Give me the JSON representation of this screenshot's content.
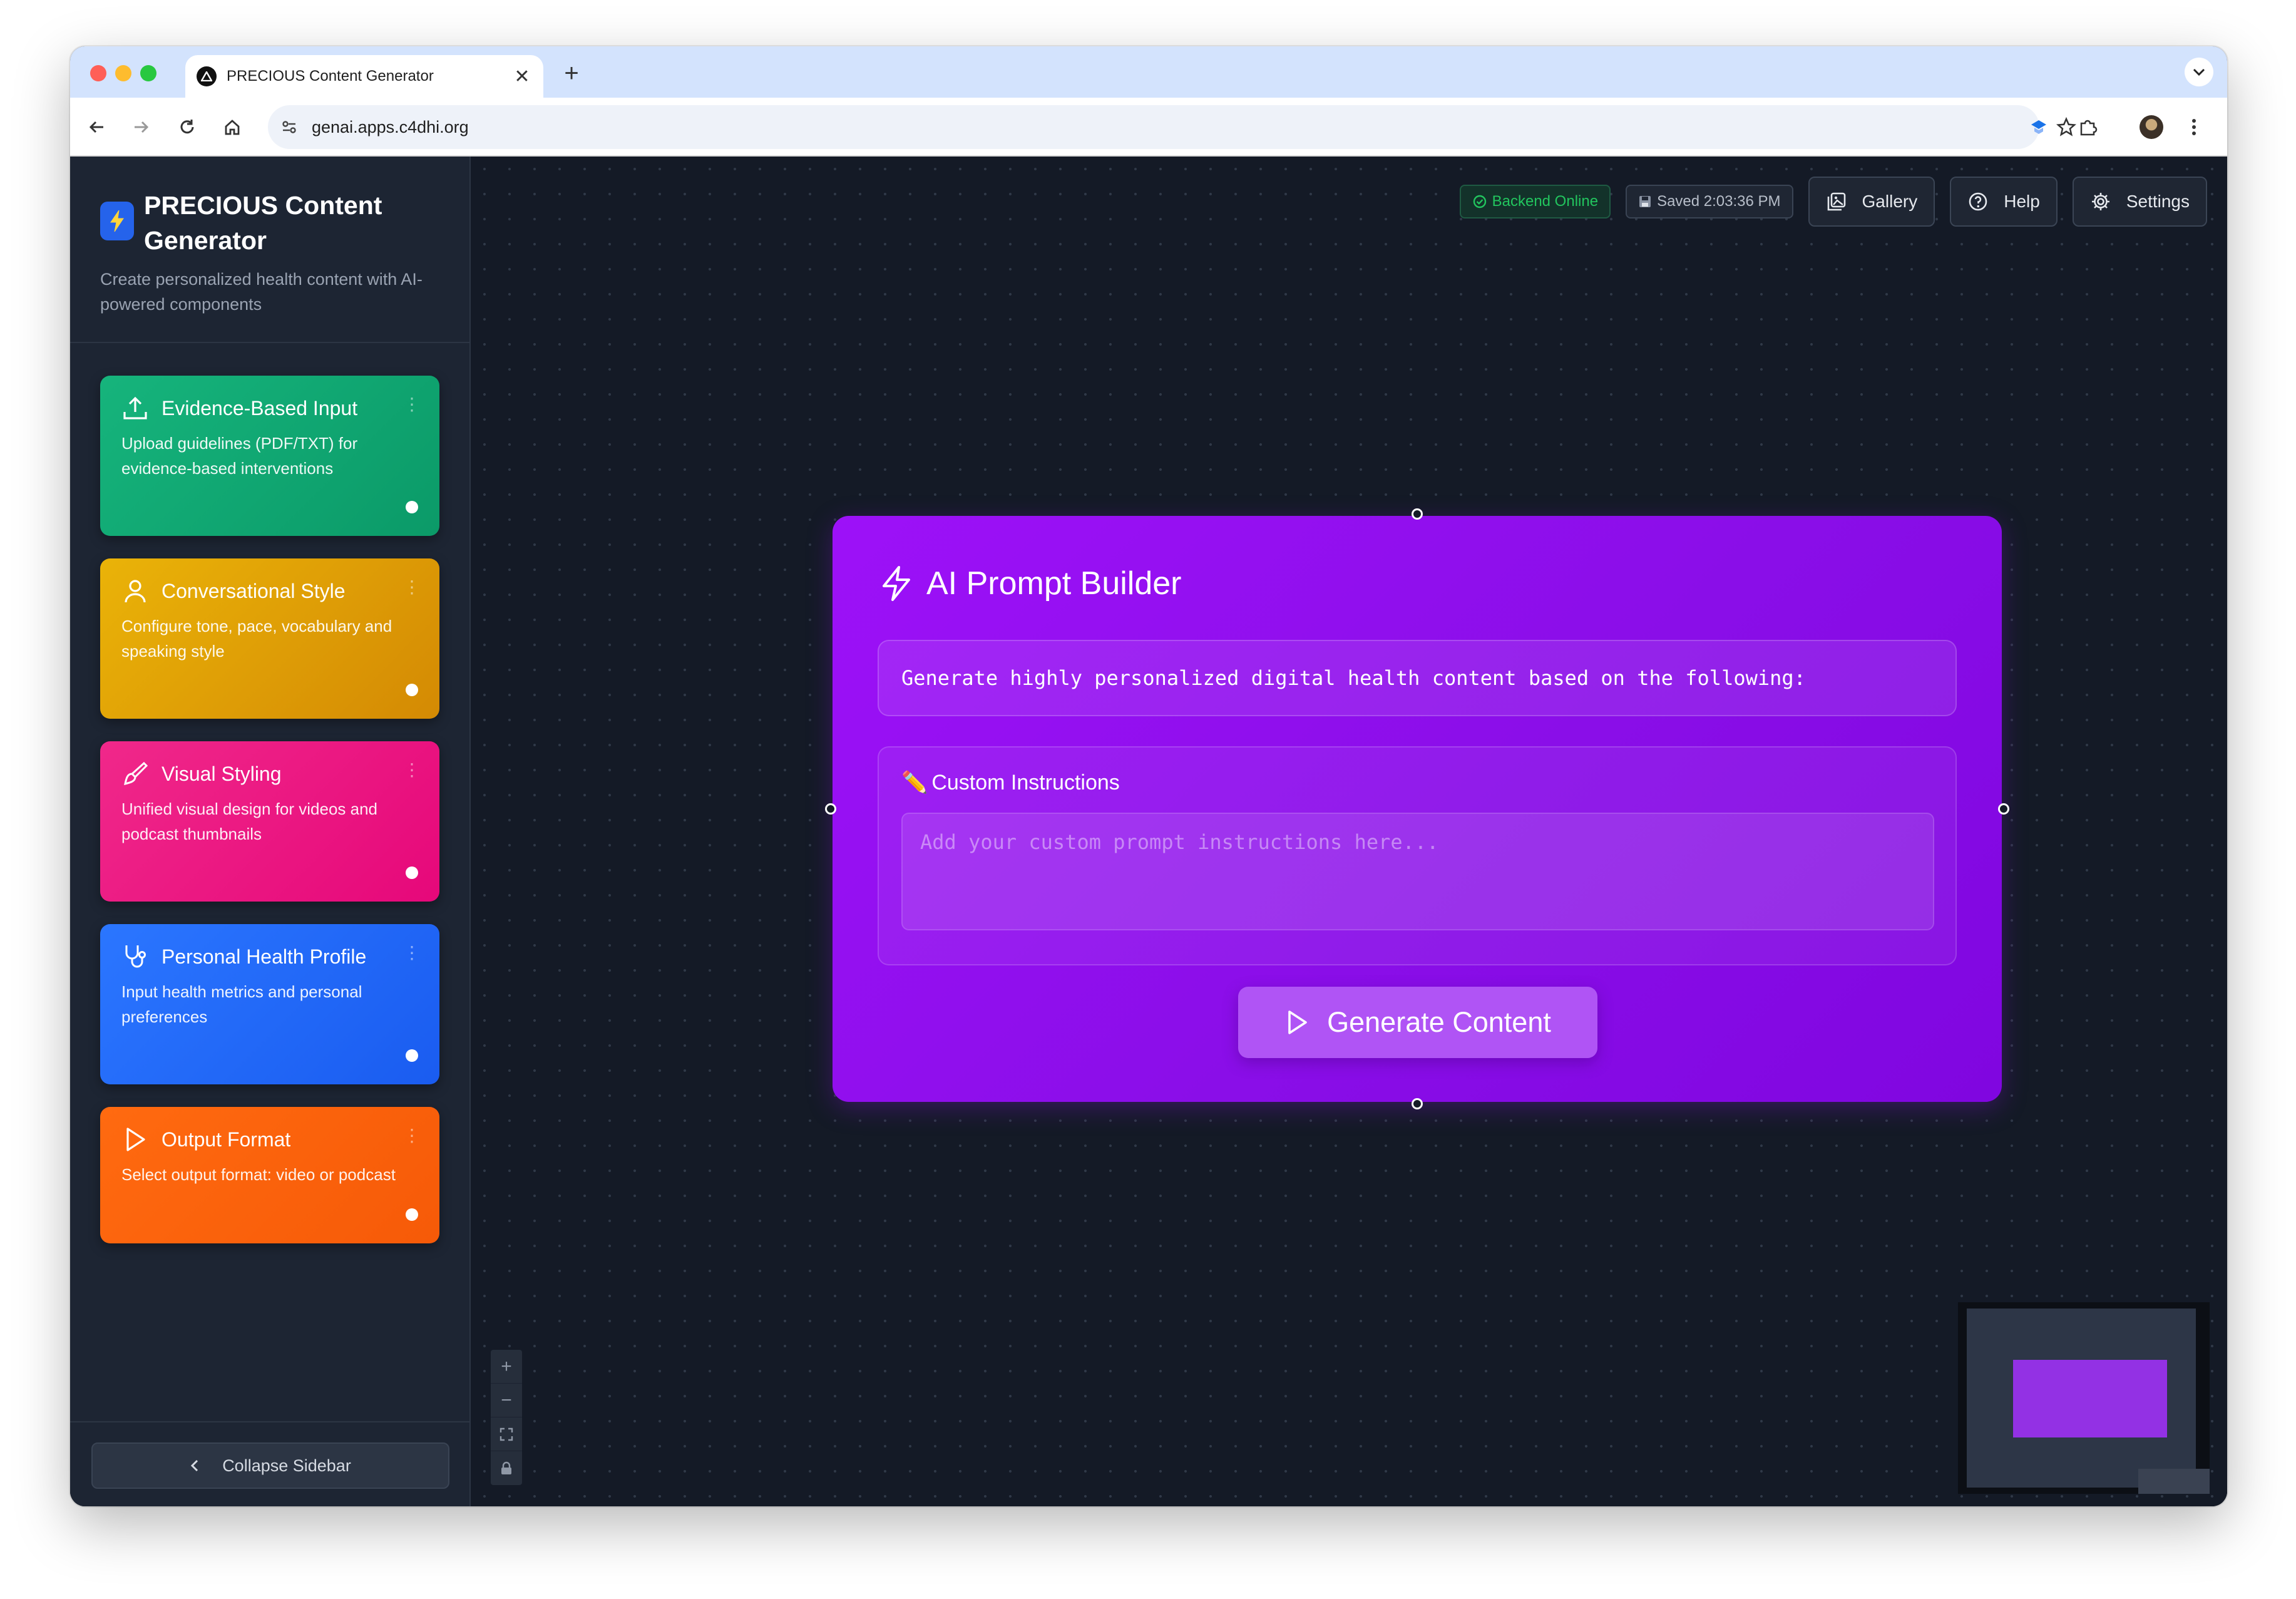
{
  "browser": {
    "tab_title": "PRECIOUS Content Generator",
    "url": "genai.apps.c4dhi.org"
  },
  "sidebar": {
    "title": "PRECIOUS Content Generator",
    "subtitle": "Create personalized health content with AI-powered components",
    "cards": [
      {
        "title": "Evidence-Based Input",
        "description": "Upload guidelines (PDF/TXT) for evidence-based interventions",
        "icon": "upload-icon",
        "color": "#10a872"
      },
      {
        "title": "Conversational Style",
        "description": "Configure tone, pace, vocabulary and speaking style",
        "icon": "user-icon",
        "color": "#e0a206"
      },
      {
        "title": "Visual Styling",
        "description": "Unified visual design for videos and podcast thumbnails",
        "icon": "paintbrush-icon",
        "color": "#ec1e84"
      },
      {
        "title": "Personal Health Profile",
        "description": "Input health metrics and personal preferences",
        "icon": "stethoscope-icon",
        "color": "#1f6cf5"
      },
      {
        "title": "Output Format",
        "description": "Select output format: video or podcast",
        "icon": "play-icon",
        "color": "#f9640c"
      }
    ],
    "collapse_label": "Collapse Sidebar"
  },
  "topbar": {
    "status": "Backend Online",
    "saved": "Saved 2:03:36 PM",
    "gallery": "Gallery",
    "help": "Help",
    "settings": "Settings"
  },
  "node": {
    "title": "AI Prompt Builder",
    "prompt_text": "Generate highly personalized digital health content based on the following:",
    "custom_label": "Custom Instructions",
    "custom_emoji": "✏️",
    "custom_placeholder": "Add your custom prompt instructions here...",
    "generate_label": "Generate Content",
    "color": "#9d11f8"
  }
}
